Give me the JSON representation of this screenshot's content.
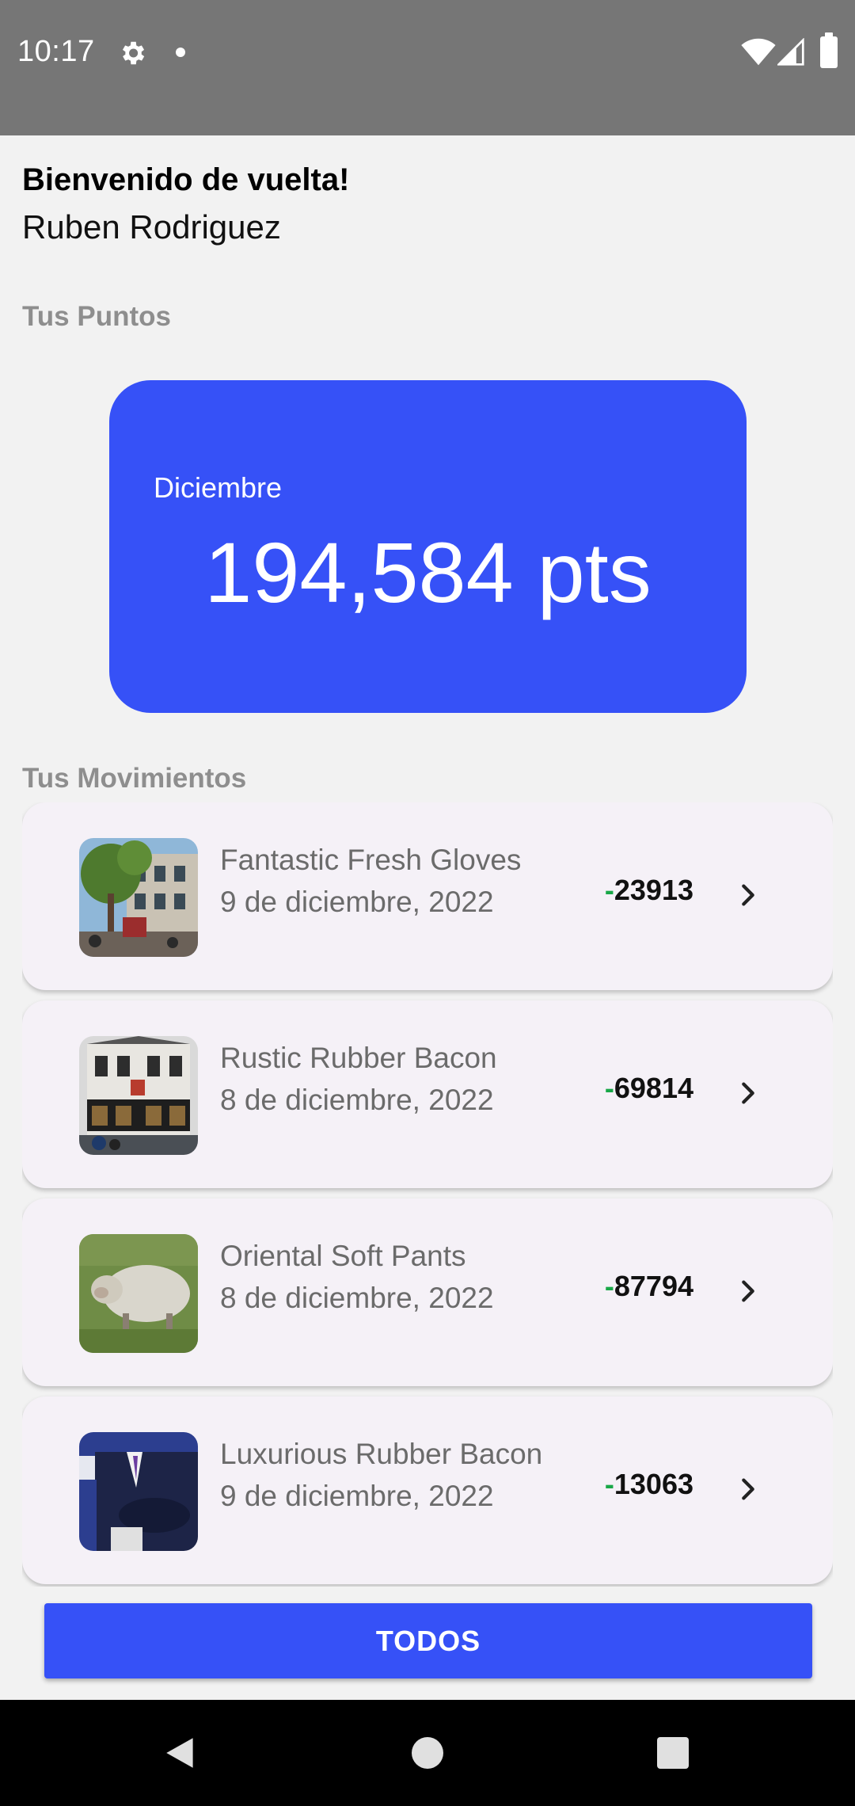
{
  "status_bar": {
    "time": "10:17"
  },
  "header": {
    "welcome": "Bienvenido de vuelta!",
    "user_name": "Ruben Rodriguez"
  },
  "points": {
    "section_title": "Tus Puntos",
    "month": "Diciembre",
    "value": "194,584 pts",
    "card_color": "#3651f7"
  },
  "movements": {
    "section_title": "Tus Movimientos",
    "items": [
      {
        "name": "Fantastic Fresh Gloves",
        "date": "9 de diciembre, 2022",
        "sign": "-",
        "amount": "23913",
        "image": "street-building-photo"
      },
      {
        "name": "Rustic Rubber Bacon",
        "date": "8 de diciembre, 2022",
        "sign": "-",
        "amount": "69814",
        "image": "pub-building-photo"
      },
      {
        "name": "Oriental Soft Pants",
        "date": "8 de diciembre, 2022",
        "sign": "-",
        "amount": "87794",
        "image": "sheep-photo"
      },
      {
        "name": "Luxurious Rubber Bacon",
        "date": "9 de diciembre, 2022",
        "sign": "-",
        "amount": "13063",
        "image": "person-suit-photo"
      }
    ]
  },
  "footer_button": {
    "label": "TODOS",
    "color": "#3651f7"
  },
  "colors": {
    "sign_color": "#19a848",
    "section_label": "#8e8e8e"
  }
}
